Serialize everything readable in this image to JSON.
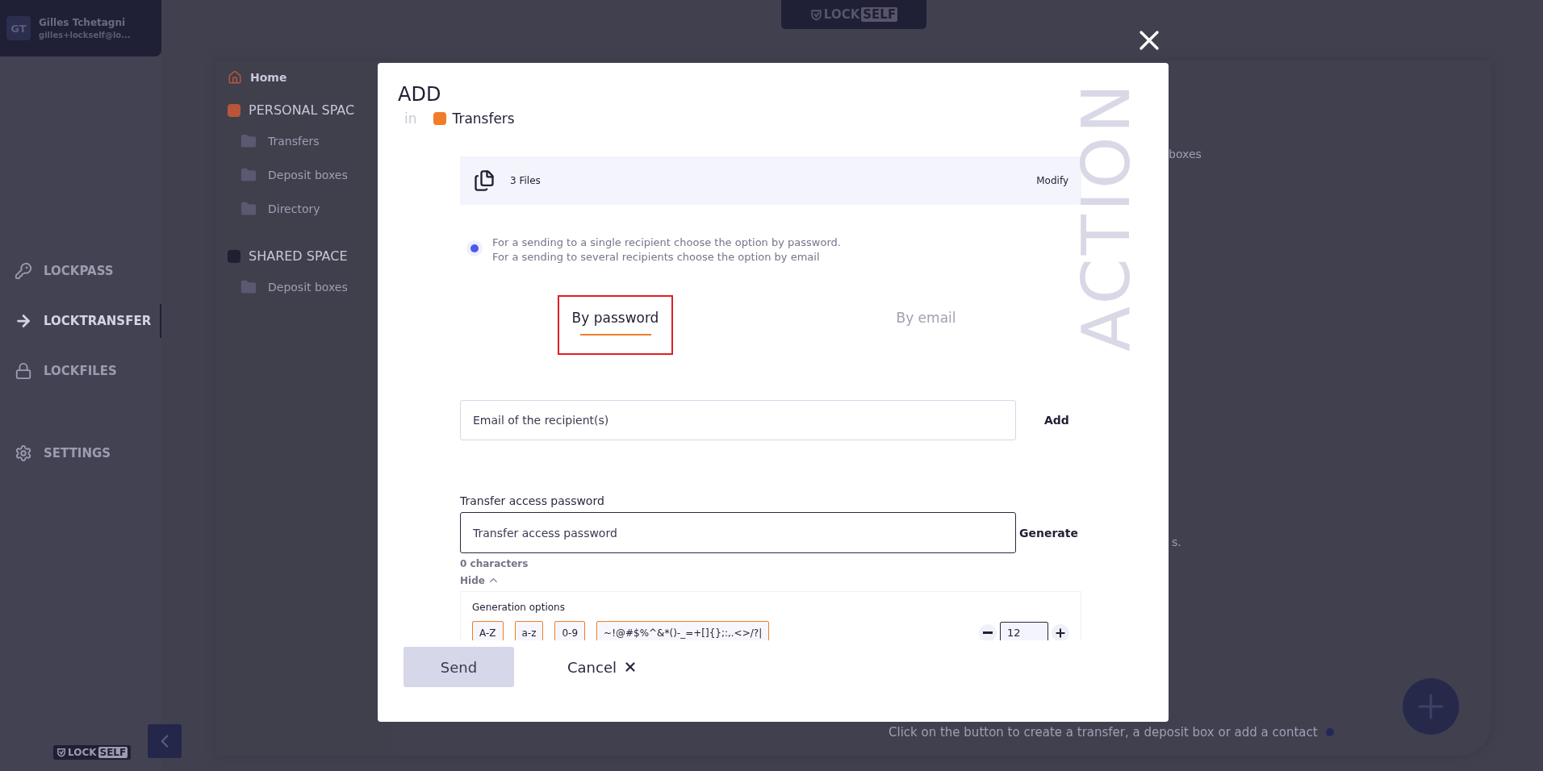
{
  "sidebar": {
    "user": {
      "initials": "GT",
      "name": "Gilles Tchetagni",
      "email": "gilles+lockself@lo..."
    },
    "items": [
      {
        "label": "LOCKPASS",
        "selected": false
      },
      {
        "label": "LOCKTRANSFER",
        "selected": true
      },
      {
        "label": "LOCKFILES",
        "selected": false
      },
      {
        "label": "SETTINGS",
        "selected": false
      }
    ],
    "logo": {
      "word": "LOCK",
      "badge": "SELF"
    }
  },
  "header_logo": {
    "word": "LOCK",
    "badge": "SELF"
  },
  "tree": {
    "home": "Home",
    "sections": [
      {
        "title": "PERSONAL SPAC",
        "color": "#b8553a",
        "folders": [
          "Transfers",
          "Deposit boxes",
          "Directory"
        ]
      },
      {
        "title": "SHARED SPACE",
        "color": "#1f1e33",
        "folders": [
          "Deposit boxes"
        ]
      }
    ]
  },
  "background": {
    "fragments": [
      "boxes",
      "s."
    ],
    "hint": "Click on the button to create a transfer, a deposit box or add a contact"
  },
  "modal": {
    "title": "ADD",
    "location_prefix": "in",
    "location": "Transfers",
    "watermark": "ACTION",
    "files": {
      "count": "3 Files",
      "action": "Modify"
    },
    "option": {
      "selected": true,
      "lines": [
        "For a sending to a single recipient choose the option by password.",
        "For a sending to several recipients choose the option by email"
      ]
    },
    "tabs": [
      {
        "label": "By password",
        "selected": true,
        "highlighted": true
      },
      {
        "label": "By email",
        "selected": false,
        "highlighted": false
      }
    ],
    "recipient": {
      "placeholder": "Email of the recipient(s)",
      "action": "Add"
    },
    "password": {
      "label": "Transfer access password",
      "placeholder": "Transfer access password",
      "action": "Generate",
      "count": "0 characters",
      "toggle": "Hide"
    },
    "generation": {
      "title": "Generation options",
      "length": "12",
      "charsets": [
        {
          "label": "A-Z",
          "selected": true
        },
        {
          "label": "a-z",
          "selected": true
        },
        {
          "label": "0-9",
          "selected": true
        },
        {
          "label": "~!@#$%^&*()-_=+[]{};:,.<>/?|",
          "selected": true
        }
      ]
    },
    "send": {
      "label": "Send",
      "disabled": true
    },
    "cancel": "Cancel"
  }
}
